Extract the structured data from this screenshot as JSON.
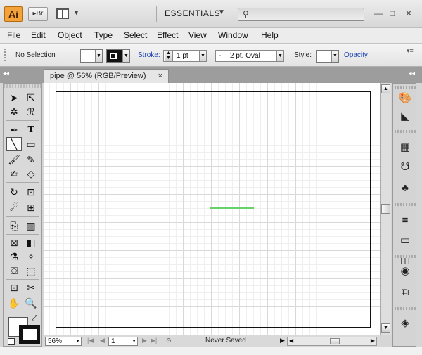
{
  "titlebar": {
    "logo": "Ai",
    "bridge": "Br",
    "workspace": "ESSENTIALS",
    "search_placeholder": ""
  },
  "menu": [
    "File",
    "Edit",
    "Object",
    "Type",
    "Select",
    "Effect",
    "View",
    "Window",
    "Help"
  ],
  "control": {
    "selection": "No Selection",
    "stroke_label": "Stroke:",
    "stroke_weight": "1 pt",
    "brush": "2 pt. Oval",
    "style_label": "Style:",
    "opacity_label": "Opacity"
  },
  "document": {
    "tab_title": "pipe @ 56% (RGB/Preview)"
  },
  "status": {
    "zoom": "56%",
    "artboard": "1",
    "save_state": "Never Saved"
  },
  "icons": {
    "close": "×",
    "caret": "▼",
    "collapse_left": "◂◂",
    "collapse_right": "◂◂"
  },
  "colors": {
    "path_stroke": "#66d36a",
    "logo_bg": "#f2a33a"
  }
}
